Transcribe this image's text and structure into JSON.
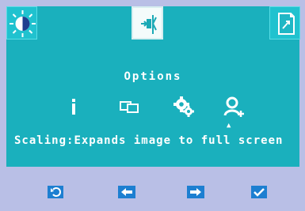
{
  "colors": {
    "panel": "#1ab0bd",
    "tab": "#20c2cf",
    "active_tab": "#f4fbfb",
    "footer": "#b9bfe6",
    "footer_icon": "#1d7fd1",
    "text": "#ffffff"
  },
  "tabs": [
    {
      "icon": "brightness-icon"
    },
    {
      "icon": "input-source-icon",
      "active": true
    },
    {
      "icon": "exit-icon"
    }
  ],
  "menu": {
    "title": "Options",
    "icons": [
      "info-icon",
      "pip-icon",
      "settings-gears-icon",
      "user-add-icon"
    ],
    "description_label": "Scaling:",
    "description_text": "Expands image to full screen"
  },
  "footer": {
    "buttons": [
      "back-icon",
      "left-arrow-icon",
      "right-arrow-icon",
      "confirm-check-icon"
    ]
  }
}
